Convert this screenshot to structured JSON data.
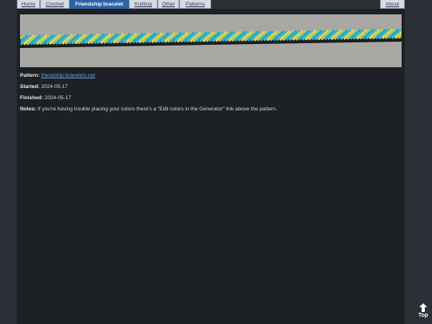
{
  "nav": {
    "items": [
      {
        "label": "Home"
      },
      {
        "label": "Crochet"
      },
      {
        "label": "Friendship bracelet",
        "active": true
      },
      {
        "label": "Knitting"
      },
      {
        "label": "Other"
      },
      {
        "label": "Patterns"
      }
    ],
    "about": "About"
  },
  "photo": {
    "alt": "Friendship bracelet",
    "colors": [
      "#2a9fd6",
      "#3cbfb0",
      "#e8cc6a",
      "#9fd05a",
      "#1a1a1a"
    ]
  },
  "info": {
    "pattern_label": "Pattern:",
    "pattern_link": "friendship-bracelets.net",
    "started_label": "Started:",
    "started_value": "2024-05-17",
    "finished_label": "Finished:",
    "finished_value": "2024-05-17",
    "notes_label": "Notes:",
    "notes_value": "If you're having trouble placing your colors there's a \"Edit colors in the Generator\" link above the pattern."
  },
  "top_button": {
    "label": "Top",
    "icon": "arrow-up-icon"
  }
}
